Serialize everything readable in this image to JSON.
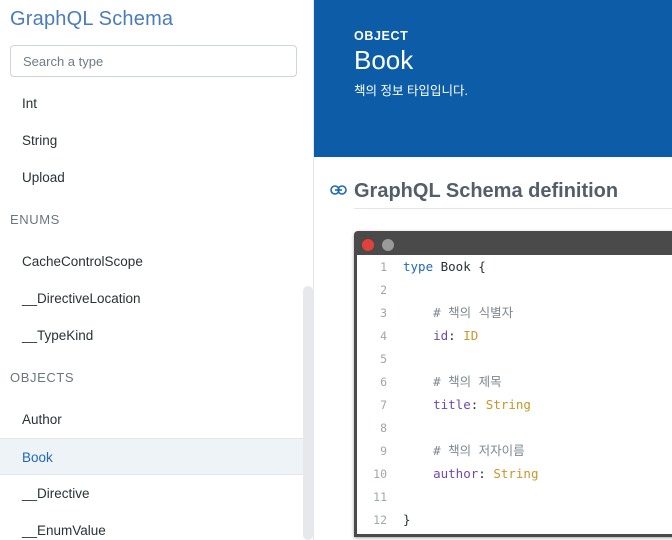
{
  "sidebar": {
    "title": "GraphQL Schema",
    "search_placeholder": "Search a type",
    "scalars": [
      "Int",
      "String",
      "Upload"
    ],
    "enums_label": "ENUMS",
    "enums": [
      "CacheControlScope",
      "__DirectiveLocation",
      "__TypeKind"
    ],
    "objects_label": "OBJECTS",
    "objects": [
      "Author",
      "Book",
      "__Directive",
      "__EnumValue"
    ],
    "active_item": "Book"
  },
  "header": {
    "kind": "OBJECT",
    "name": "Book",
    "description": "책의 정보 타입입니다."
  },
  "definition": {
    "title": "GraphQL Schema definition",
    "lines": [
      {
        "n": "1",
        "parts": [
          {
            "c": "kw",
            "t": "type"
          },
          {
            "c": "tx",
            "t": " Book {"
          }
        ]
      },
      {
        "n": "2",
        "parts": []
      },
      {
        "n": "3",
        "parts": [
          {
            "c": "cm",
            "t": "    # 책의 식별자"
          }
        ]
      },
      {
        "n": "4",
        "parts": [
          {
            "c": "fld",
            "t": "    id"
          },
          {
            "c": "tx",
            "t": ": "
          },
          {
            "c": "tp",
            "t": "ID"
          }
        ]
      },
      {
        "n": "5",
        "parts": []
      },
      {
        "n": "6",
        "parts": [
          {
            "c": "cm",
            "t": "    # 책의 제목"
          }
        ]
      },
      {
        "n": "7",
        "parts": [
          {
            "c": "fld",
            "t": "    title"
          },
          {
            "c": "tx",
            "t": ": "
          },
          {
            "c": "tp",
            "t": "String"
          }
        ]
      },
      {
        "n": "8",
        "parts": []
      },
      {
        "n": "9",
        "parts": [
          {
            "c": "cm",
            "t": "    # 책의 저자이름"
          }
        ]
      },
      {
        "n": "10",
        "parts": [
          {
            "c": "fld",
            "t": "    author"
          },
          {
            "c": "tx",
            "t": ": "
          },
          {
            "c": "tp",
            "t": "String"
          }
        ]
      },
      {
        "n": "11",
        "parts": []
      },
      {
        "n": "12",
        "parts": [
          {
            "c": "tx",
            "t": "}"
          }
        ]
      }
    ]
  },
  "colors": {
    "header_bg": "#0c5ca8",
    "accent": "#1f69b8",
    "sidebar_title": "#4a7bbd"
  },
  "icons": {
    "section_link": "link-icon",
    "window_close": "close-dot",
    "window_minimize": "minimize-dot"
  }
}
